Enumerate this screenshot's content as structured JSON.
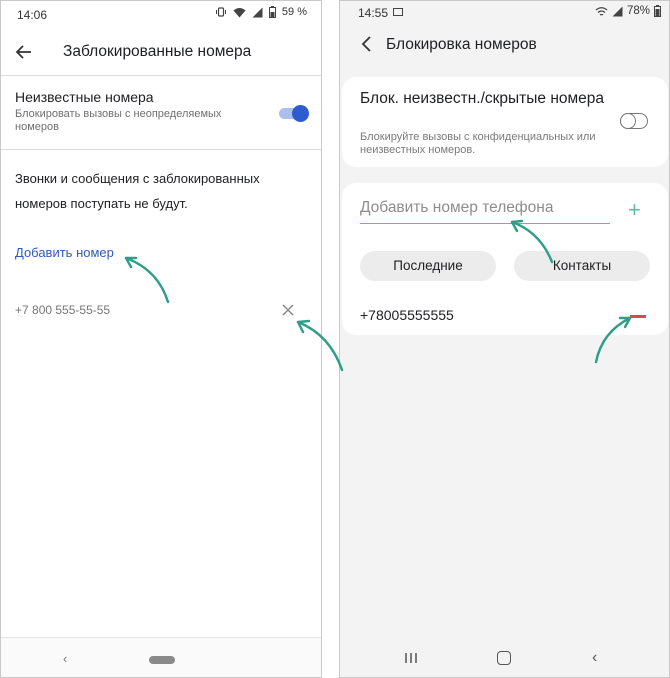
{
  "left": {
    "status": {
      "time": "14:06",
      "battery": "59 %"
    },
    "title": "Заблокированные номера",
    "unknown": {
      "title": "Неизвестные номера",
      "subtitle": "Блокировать вызовы с неопределяемых номеров",
      "toggle_on": true
    },
    "info": "Звонки и сообщения с заблокированных номеров поступать не будут.",
    "add_label": "Добавить номер",
    "blocked_number": "+7 800 555-55-55",
    "nav": {
      "back_glyph": "‹"
    }
  },
  "right": {
    "status": {
      "time": "14:55",
      "battery": "78%"
    },
    "title": "Блокировка номеров",
    "unknown": {
      "title": "Блок. неизвестн./скрытые номера",
      "subtitle": "Блокируйте вызовы с конфиденциальных или неизвестных номеров.",
      "toggle_on": false
    },
    "input_placeholder": "Добавить номер телефона",
    "plus_glyph": "+",
    "recent_label": "Последние",
    "contacts_label": "Контакты",
    "blocked_number": "+78005555555",
    "nav": {
      "back_glyph": "‹"
    }
  },
  "colors": {
    "toggle_on": "#2f5bd0",
    "link": "#2f5bbb",
    "accent_teal": "#5fbba8",
    "remove_red": "#e14b2f",
    "annotation_arrow": "#2e9e86"
  }
}
